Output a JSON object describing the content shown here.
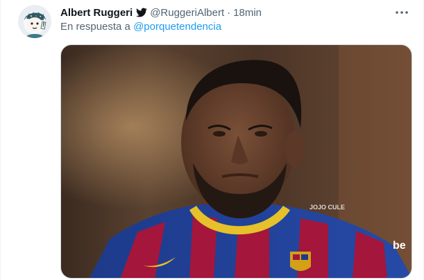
{
  "tweet": {
    "author": {
      "display_name": "Albert Ruggeri",
      "handle": "@RuggeriAlbert",
      "badge_icon": "bird-icon",
      "avatar_icon": "cartoon-avatar"
    },
    "separator": "·",
    "time": "18min",
    "reply": {
      "prefix": "En respuesta a ",
      "mention": "@porquetendencia"
    },
    "media": {
      "watermark": "JOJO CULE",
      "kind": "photo"
    },
    "more_icon": "ellipsis-icon"
  },
  "colors": {
    "text_primary": "#0f1419",
    "text_secondary": "#536471",
    "link": "#1d9bf0",
    "border": "#cfd9de"
  }
}
